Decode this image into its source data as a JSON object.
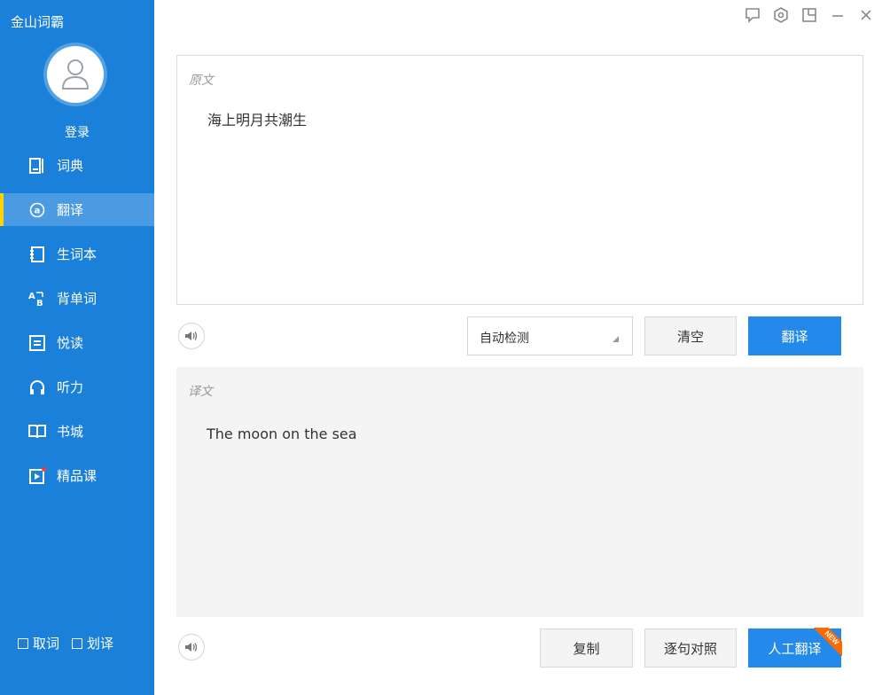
{
  "app": {
    "title": "金山词霸"
  },
  "user": {
    "login_label": "登录"
  },
  "sidebar": {
    "items": [
      {
        "label": "词典",
        "icon": "dictionary-icon"
      },
      {
        "label": "翻译",
        "icon": "translate-icon",
        "active": true
      },
      {
        "label": "生词本",
        "icon": "wordbook-icon"
      },
      {
        "label": "背单词",
        "icon": "ab-vocabulary-icon"
      },
      {
        "label": "悦读",
        "icon": "reading-icon"
      },
      {
        "label": "听力",
        "icon": "headphones-icon"
      },
      {
        "label": "书城",
        "icon": "bookstore-icon"
      },
      {
        "label": "精品课",
        "icon": "course-play-icon"
      }
    ],
    "options": [
      {
        "label": "取词",
        "checked": false
      },
      {
        "label": "划译",
        "checked": false
      }
    ]
  },
  "window_controls": [
    "feedback-icon",
    "settings-icon",
    "mini-mode-icon",
    "minimize-icon",
    "close-icon"
  ],
  "source": {
    "label": "原文",
    "text": "海上明月共潮生"
  },
  "toolbar": {
    "language": "自动检测",
    "clear_label": "清空",
    "translate_label": "翻译"
  },
  "target": {
    "label": "译文",
    "text": "The moon on the sea"
  },
  "bottom_bar": {
    "copy_label": "复制",
    "compare_label": "逐句对照",
    "human_translate_label": "人工翻译",
    "new_badge": "NEW"
  },
  "colors": {
    "sidebar": "#1a80d9",
    "sidebar_active": "#4b9be3",
    "active_indicator": "#ffd400",
    "primary_button": "#2389ea",
    "new_badge": "#ff6a00"
  }
}
